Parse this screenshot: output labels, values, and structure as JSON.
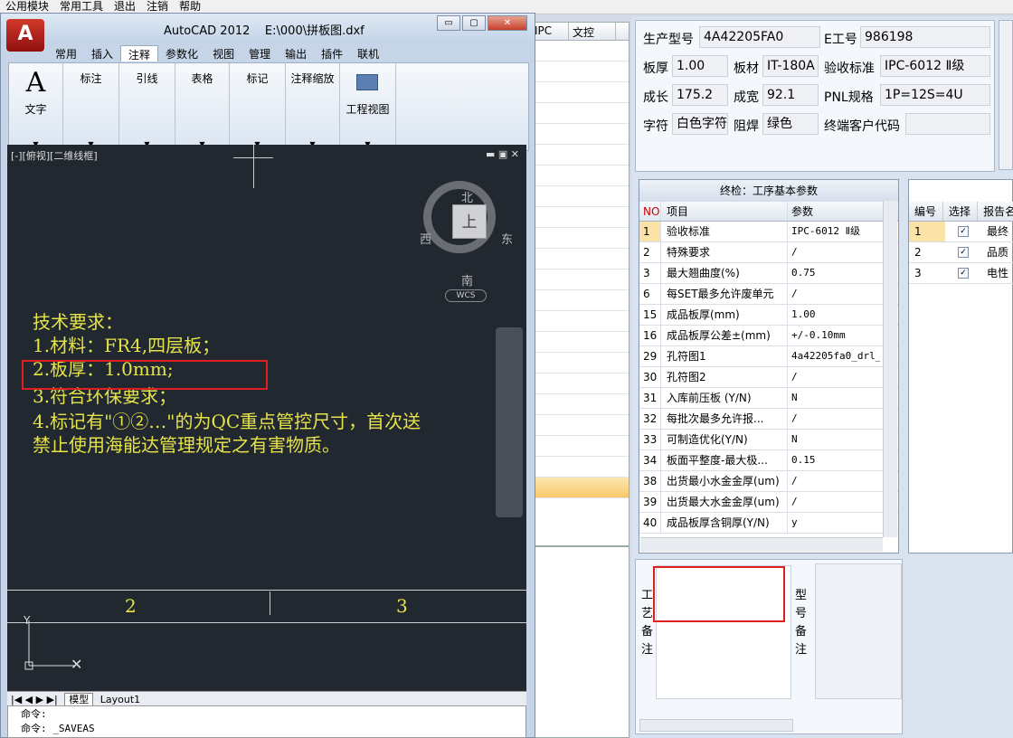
{
  "host_menu": [
    "公用模块",
    "常用工具",
    "退出",
    "注销",
    "帮助"
  ],
  "background_grid": {
    "col1": "IPC",
    "col2": "文控"
  },
  "acad": {
    "title": "AutoCAD 2012",
    "file": "E:\\000\\拼板图.dxf",
    "tabs": [
      "常用",
      "插入",
      "注释",
      "参数化",
      "视图",
      "管理",
      "输出",
      "插件",
      "联机"
    ],
    "active_tab": "注释",
    "ribbon_panels": [
      "文字",
      "标注",
      "引线",
      "表格",
      "标记",
      "注释缩放",
      "工程视图"
    ],
    "view_label": "[-][俯视][二维线框]",
    "compass": {
      "n": "北",
      "s": "南",
      "e": "东",
      "w": "西",
      "top": "上"
    },
    "wcs": "WCS",
    "tech_lines": [
      "技术要求：",
      "1.材料：FR4,四层板；",
      "2.板厚：1.0mm;",
      "3.符合环保要求；",
      "4.标记有\"①②…\"的为QC重点管控尺寸，首次送",
      "  禁止使用海能达管理规定之有害物质。"
    ],
    "label_2": "2",
    "label_3": "3",
    "layout_tabs": {
      "model": "模型",
      "layout": "Layout1"
    },
    "cmd1": "命令:",
    "cmd2": "命令: _SAVEAS",
    "win_buttons": {
      "min": "▭",
      "max": "▢",
      "close": "✕"
    },
    "vp_ctrl": "▬ ▣ ✕"
  },
  "info": {
    "model_label": "生产型号",
    "model": "4A42205FA0",
    "eno_label": "E工号",
    "eno": "986198",
    "thick_label": "板厚",
    "thick": "1.00",
    "material_label": "板材",
    "material": "IT-180A",
    "accept_label": "验收标准",
    "accept": "IPC-6012 Ⅱ级",
    "len_label": "成长",
    "len": "175.2",
    "width_label": "成宽",
    "width": "92.1",
    "pnl_label": "PNL规格",
    "pnl": "1P=12S=4U",
    "char_label": "字符",
    "char": "白色字符",
    "mask_label": "阻焊",
    "mask": "绿色",
    "cust_label": "终端客户代码",
    "cust": ""
  },
  "grid": {
    "title": "终检：工序基本参数",
    "headers": [
      "NO",
      "项目",
      "参数"
    ],
    "rows": [
      {
        "no": "1",
        "item": "验收标准",
        "value": "IPC-6012 Ⅱ级"
      },
      {
        "no": "2",
        "item": "特殊要求",
        "value": "/"
      },
      {
        "no": "3",
        "item": "最大翘曲度(%)",
        "value": "0.75"
      },
      {
        "no": "6",
        "item": "每SET最多允许废单元",
        "value": "/"
      },
      {
        "no": "15",
        "item": "成品板厚(mm)",
        "value": "1.00"
      },
      {
        "no": "16",
        "item": "成品板厚公差±(mm)",
        "value": "+/-0.10mm"
      },
      {
        "no": "29",
        "item": "孔符图1",
        "value": "4a42205fa0_drl_"
      },
      {
        "no": "30",
        "item": "孔符图2",
        "value": "/"
      },
      {
        "no": "31",
        "item": "入库前压板 (Y/N)",
        "value": "N"
      },
      {
        "no": "32",
        "item": "每批次最多允许报...",
        "value": "/"
      },
      {
        "no": "33",
        "item": "可制造优化(Y/N)",
        "value": "N"
      },
      {
        "no": "34",
        "item": "板面平整度-最大极...",
        "value": "0.15"
      },
      {
        "no": "38",
        "item": "出货最小水金金厚(um)",
        "value": "/"
      },
      {
        "no": "39",
        "item": "出货最大水金金厚(um)",
        "value": "/"
      },
      {
        "no": "40",
        "item": "成品板厚含铜厚(Y/N)",
        "value": "y"
      }
    ]
  },
  "report": {
    "headers": [
      "编号",
      "选择",
      "报告名"
    ],
    "rows": [
      {
        "no": "1",
        "name": "最终"
      },
      {
        "no": "2",
        "name": "品质"
      },
      {
        "no": "3",
        "name": "电性"
      }
    ]
  },
  "remarks": {
    "process_label": "工艺备注",
    "model_label": "型号备注"
  },
  "colors": {
    "cad_bg": "#212830",
    "cad_text": "#e6e34a",
    "highlight": "#e02020"
  }
}
